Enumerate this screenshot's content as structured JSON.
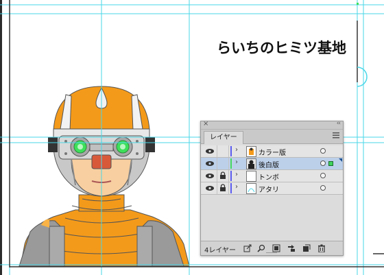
{
  "artwork": {
    "title_text": "らいちのヒミツ基地"
  },
  "panel": {
    "close_glyph": "×",
    "collapse_glyph": "‹‹",
    "tab_label": "レイヤー",
    "menu_icon": "menu-icon",
    "layers": [
      {
        "name": "カラー版",
        "visible": true,
        "locked": false,
        "color": "#5b5bf0",
        "selected": false,
        "thumb": "color-thumb"
      },
      {
        "name": "後白版",
        "visible": true,
        "locked": false,
        "color": "#44d95e",
        "selected": true,
        "thumb": "silhouette-thumb"
      },
      {
        "name": "トンボ",
        "visible": true,
        "locked": true,
        "color": "#5b5bf0",
        "selected": false,
        "thumb": "blank-thumb"
      },
      {
        "name": "アタリ",
        "visible": true,
        "locked": true,
        "color": "#5b5bf0",
        "selected": false,
        "thumb": "sketch-thumb"
      }
    ],
    "footer_count": "4レイヤー",
    "footer_icons": [
      "export-icon",
      "search-icon",
      "clipping-mask-icon",
      "new-sublayer-icon",
      "new-layer-icon",
      "trash-icon"
    ]
  },
  "colors": {
    "guide_cyan": "#47d7e8",
    "helmet_orange": "#f49a1a",
    "face_peach": "#f8cfa0",
    "goggle_green": "#3ee05a",
    "mouth_red": "#d8583a",
    "selection_blue": "#bcd0ea"
  }
}
